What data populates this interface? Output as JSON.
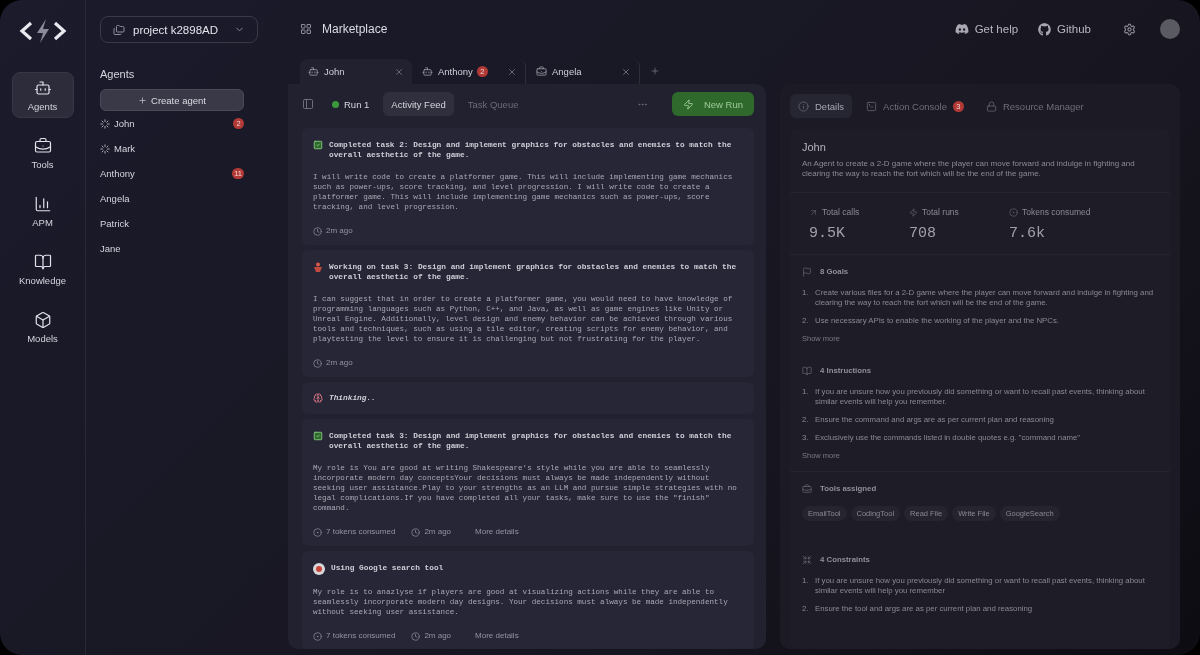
{
  "nav": [
    {
      "label": "Agents",
      "selected": true
    },
    {
      "label": "Tools",
      "selected": false
    },
    {
      "label": "APM",
      "selected": false
    },
    {
      "label": "Knowledge",
      "selected": false
    },
    {
      "label": "Models",
      "selected": false
    }
  ],
  "project": {
    "name": "project k2898AD"
  },
  "agents_panel": {
    "title": "Agents",
    "create_button": "Create agent",
    "agents": [
      {
        "name": "John",
        "running": true,
        "badge": "2"
      },
      {
        "name": "Mark",
        "running": true
      },
      {
        "name": "Anthony",
        "running": false,
        "badge": "11"
      },
      {
        "name": "Angela",
        "running": false
      },
      {
        "name": "Patrick",
        "running": false
      },
      {
        "name": "Jane",
        "running": false
      }
    ]
  },
  "top_bar": {
    "title": "Marketplace",
    "help": "Get help",
    "github": "Github"
  },
  "tabs": [
    {
      "kind": "agent",
      "label": "John",
      "selected": true
    },
    {
      "kind": "agent",
      "label": "Anthony",
      "selected": false,
      "badge": "2"
    },
    {
      "kind": "tool",
      "label": "Angela",
      "selected": false
    }
  ],
  "feed_toolbar": {
    "run": "Run 1",
    "views": [
      {
        "label": "Activity Feed",
        "selected": true
      },
      {
        "label": "Task Queue",
        "selected": false
      }
    ],
    "new_run": "New Run"
  },
  "feed": [
    {
      "kind": "completed",
      "title": "Completed task 2: Design and implement graphics for obstacles and enemies to match the overall aesthetic of the game.",
      "body": "I will write code to create a platformer game. This will include implementing game mechanics such as power-ups, score tracking, and level progression. I will write code to create a platformer game. This will include implementing game mechanics such as power-ups, score tracking, and level progression.",
      "time": "2m ago"
    },
    {
      "kind": "working",
      "title": "Working on task 3: Design and implement graphics for obstacles and enemies to match the overall aesthetic of the game.",
      "body": "I can suggest that in order to create a platformer game, you would need to have knowledge of programming languages such as Python, C++, and Java, as well as game engines like Unity or Unreal Engine. Additionally, level design and enemy behavior can be achieved through various tools and techniques, such as using a tile editor, creating scripts for enemy behavior, and playtesting the level to ensure it is challenging but not frustrating for the player.",
      "time": "2m ago"
    },
    {
      "kind": "thinking",
      "title": "Thinking.."
    },
    {
      "kind": "completed",
      "title": "Completed task 3: Design and implement graphics for obstacles and enemies to match the overall aesthetic of the game.",
      "body": "My role is You are good at writing Shakespeare's style while you are able to seamlessly incorporate modern day conceptsYour decisions must always be made independently without seeking user assistance.Play to your strengths as an LLM and pursue simple strategies with no legal complications.If you have completed all your tasks, make sure to use the \"finish\" command.",
      "tokens": "7 tokens consumed",
      "time": "2m ago",
      "more": "More details"
    },
    {
      "kind": "tool",
      "title": "Using Google search tool",
      "body": "My role is to anazlyse if players are good at visualizing actions while they are able to seamlessly incorporate modern day designs. Your decisions must always be made independently without seeking user assistance.",
      "tokens": "7 tokens consumed",
      "time": "2m ago",
      "more": "More details"
    }
  ],
  "details": {
    "tabs": [
      {
        "label": "Details",
        "selected": true
      },
      {
        "label": "Action Console",
        "selected": false,
        "badge": "3"
      },
      {
        "label": "Resource Manager",
        "selected": false
      }
    ],
    "name": "John",
    "description": "An Agent to create  a 2-D game where the player can move forward and indulge in fighting and clearing the way to reach the fort which will be the end of the game.",
    "stats": [
      {
        "label": "Total calls",
        "value": "9.5K"
      },
      {
        "label": "Total runs",
        "value": "708"
      },
      {
        "label": "Tokens consumed",
        "value": "7.6k"
      }
    ],
    "sections": [
      {
        "kind": "list",
        "title": "8 Goals",
        "items": [
          {
            "number": "1.",
            "text": "Create various files for a 2-D game where the player can move forward and indulge in fighting and clearing the way to reach the fort which will be the end of the game."
          },
          {
            "number": "2.",
            "text": "Use necessary APIs to enable the working of the player and the NPCs."
          }
        ],
        "more": "Show more"
      },
      {
        "kind": "list",
        "title": "4 Instructions",
        "items": [
          {
            "number": "1.",
            "text": "If you are unsure how you previously did something or want to recall past events, thinking about similar events will help you remember."
          },
          {
            "number": "2.",
            "text": "Ensure the command and args are as per current plan and reasoning"
          },
          {
            "number": "3.",
            "text": "Exclusively use the commands listed in double quotes e.g. \"command name\""
          }
        ],
        "more": "Show more"
      },
      {
        "kind": "chips",
        "title": "Tools assigned",
        "items": [
          "EmailTool",
          "CodingTool",
          "Read File",
          "Write File",
          "GoogleSearch"
        ]
      },
      {
        "kind": "list",
        "title": "4 Constraints",
        "items": [
          {
            "number": "1.",
            "text": "If you are unsure how you previously did something or want to recall past events, thinking about similar events will help you remember"
          },
          {
            "number": "2.",
            "text": "Ensure the tool and args are as per current plan and reasoning"
          }
        ]
      }
    ]
  }
}
